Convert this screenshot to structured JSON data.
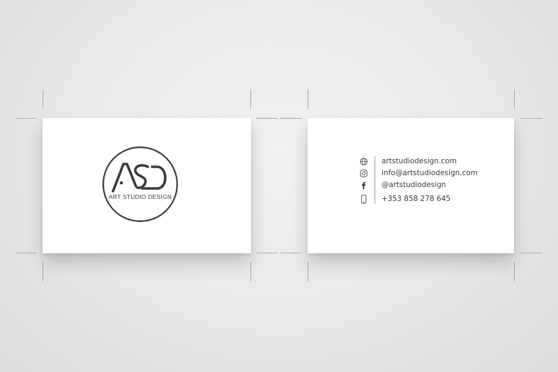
{
  "front": {
    "logo_monogram": "ASD",
    "brand_name": "ART STUDIO DESIGN"
  },
  "back": {
    "contacts": [
      {
        "icon": "globe-icon",
        "text": "artstudiodesign.com"
      },
      {
        "icon": "instagram-icon",
        "text": "info@artstudiodesign.com"
      },
      {
        "icon": "facebook-icon",
        "text": "@artstudiodesign"
      },
      {
        "icon": "phone-icon",
        "text": "+353 858 278 645"
      }
    ]
  },
  "colors": {
    "ink": "#3a3a3a",
    "card": "#ffffff",
    "background": "#e8e8e8"
  }
}
